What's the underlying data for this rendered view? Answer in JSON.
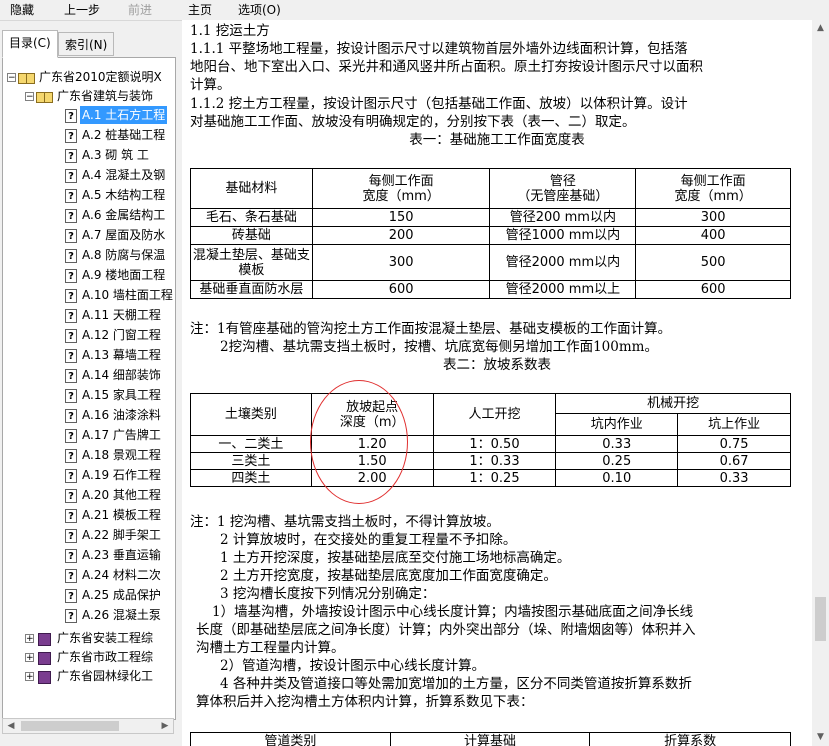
{
  "toolbar": {
    "hide": "隐藏",
    "back": "上一步",
    "forward": "前进",
    "home": "主页",
    "options": "选项(O)"
  },
  "tabs": {
    "contents": "目录(C)",
    "index": "索引(N)"
  },
  "tree": {
    "root": "广东省2010定额说明Ⅹ",
    "building": "广东省建筑与装饰",
    "items": [
      "A.1 土石方工程",
      "A.2 桩基础工程",
      "A.3 砌 筑 工",
      "A.4 混凝土及钢",
      "A.5 木结构工程",
      "A.6 金属结构工",
      "A.7 屋面及防水",
      "A.8 防腐与保温",
      "A.9 楼地面工程",
      "A.10 墙柱面工程",
      "A.11 天棚工程",
      "A.12 门窗工程",
      "A.13 幕墙工程",
      "A.14 细部装饰",
      "A.15 家具工程",
      "A.16 油漆涂料",
      "A.17 广告牌工",
      "A.18 景观工程",
      "A.19 石作工程",
      "A.20 其他工程",
      "A.21 模板工程",
      "A.22 脚手架工",
      "A.23 垂直运输",
      "A.24 材料二次",
      "A.25 成品保护",
      "A.26 混凝土泵"
    ],
    "installation": "广东省安装工程综",
    "municipal": "广东省市政工程综",
    "landscape": "广东省园林绿化工"
  },
  "doc": {
    "heading": "1.1  挖运土方",
    "p1_l1": "1.1.1  平整场地工程量，按设计图示尺寸以建筑物首层外墙外边线面积计算，包括落",
    "p1_l2": "地阳台、地下室出入口、采光井和通风竖井所占面积。原土打夯按设计图示尺寸以面积",
    "p1_l3": "计算。",
    "p2_l1": "1.1.2  挖土方工程量，按设计图示尺寸（包括基础工作面、放坡）以体积计算。设计",
    "p2_l2": "对基础施工工作面、放坡没有明确规定的，分别按下表（表一、二）取定。",
    "table1_title": "表一：基础施工工作面宽度表",
    "table1": {
      "h_material": "基础材料",
      "h_width1_l1": "每侧工作面",
      "h_width1_l2": "宽度（mm）",
      "h_pipe_l1": "管径",
      "h_pipe_l2": "（无管座基础）",
      "h_width2_l1": "每侧工作面",
      "h_width2_l2": "宽度（mm）",
      "rows": [
        {
          "material": "毛石、条石基础",
          "w1": "150",
          "pipe": "管径200 mm以内",
          "w2": "300"
        },
        {
          "material": "砖基础",
          "w1": "200",
          "pipe": "管径1000 mm以内",
          "w2": "400"
        },
        {
          "material_l1": "混凝土垫层、基础支",
          "material_l2": "模板",
          "w1": "300",
          "pipe": "管径2000 mm以内",
          "w2": "500"
        },
        {
          "material": "基础垂直面防水层",
          "w1": "600",
          "pipe": "管径2000 mm以上",
          "w2": "600"
        }
      ]
    },
    "note1_l1": "注：1有管座基础的管沟挖土方工作面按混凝土垫层、基础支模板的工作面计算。",
    "note1_l2": "2挖沟槽、基坑需支挡土板时，按槽、坑底宽每侧另增加工作面100mm。",
    "table2_title": "表二：放坡系数表",
    "table2": {
      "h_soil": "土壤类别",
      "h_depth_l1": "放坡起点",
      "h_depth_l2": "深度（m）",
      "h_manual": "人工开挖",
      "h_mech": "机械开挖",
      "h_pit_in": "坑内作业",
      "h_pit_on": "坑上作业",
      "rows": [
        {
          "soil": "一、二类土",
          "depth": "1.20",
          "manual": "1：0.50",
          "in": "0.33",
          "on": "0.75"
        },
        {
          "soil": "三类土",
          "depth": "1.50",
          "manual": "1：0.33",
          "in": "0.25",
          "on": "0.67"
        },
        {
          "soil": "四类土",
          "depth": "2.00",
          "manual": "1：0.25",
          "in": "0.10",
          "on": "0.33"
        }
      ]
    },
    "note2": [
      "注：1  挖沟槽、基坑需支挡土板时，不得计算放坡。",
      "2  计算放坡时，在交接处的重复工程量不予扣除。",
      "1  土方开挖深度，按基础垫层底至交付施工场地标高确定。",
      "2  土方开挖宽度，按基础垫层底宽度加工作面宽度确定。",
      "3  挖沟槽长度按下列情况分别确定：",
      "1）墙基沟槽，外墙按设计图示中心线长度计算；内墙按图示基础底面之间净长线",
      "长度（即基础垫层底之间净长度）计算；内外突出部分（垛、附墙烟囱等）体积并入",
      "沟槽土方工程量内计算。",
      "2）管道沟槽，按设计图示中心线长度计算。",
      "4  各种井类及管道接口等处需加宽增加的土方量，区分不同类管道按折算系数折",
      "算体积后并入挖沟槽土方体积内计算，折算系数见下表："
    ],
    "table3": {
      "h1": "管道类别",
      "h2": "计算基础",
      "h3": "折算系数"
    }
  }
}
